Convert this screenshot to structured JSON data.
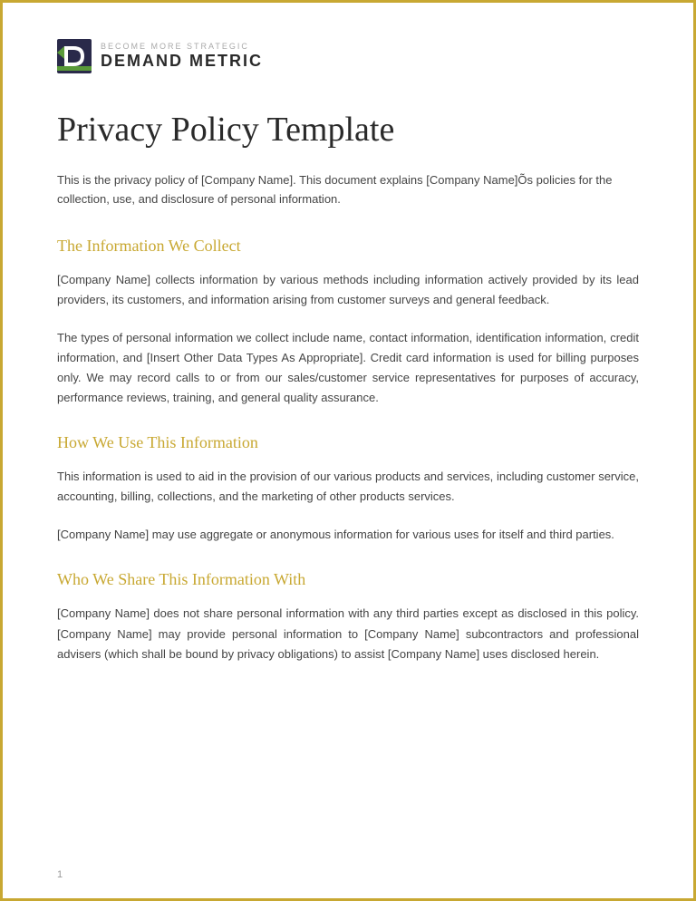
{
  "header": {
    "tagline": "Become More Strategic",
    "logo_name": "DEMAND METRIC"
  },
  "page_title": "Privacy Policy Template",
  "intro": "This is the privacy policy of [Company Name]. This document explains [Company Name]Õs policies for the collection, use, and disclosure of personal information.",
  "sections": [
    {
      "heading": "The Information We Collect",
      "paragraphs": [
        "[Company Name] collects information by various methods including information actively provided by its lead providers, its customers, and information arising from customer surveys and general feedback.",
        "The types of personal information we collect include name, contact information, identification information, credit information, and [Insert Other Data Types As Appropriate]. Credit card information is used for billing purposes only. We may record calls to or from our sales/customer service representatives for purposes of accuracy, performance reviews, training, and general quality assurance."
      ]
    },
    {
      "heading": "How We Use This Information",
      "paragraphs": [
        "This information is used to aid in the provision of our various products and services, including customer service, accounting, billing, collections, and the marketing of other products services.",
        "[Company Name] may use aggregate or anonymous information for various uses for itself and third parties."
      ]
    },
    {
      "heading": "Who We Share This Information With",
      "paragraphs": [
        "[Company Name] does not share personal information with any third parties except as disclosed in this policy. [Company Name] may provide personal information to [Company Name] subcontractors and professional advisers (which shall be bound by privacy obligations) to assist [Company Name] uses disclosed herein."
      ]
    }
  ],
  "page_number": "1"
}
